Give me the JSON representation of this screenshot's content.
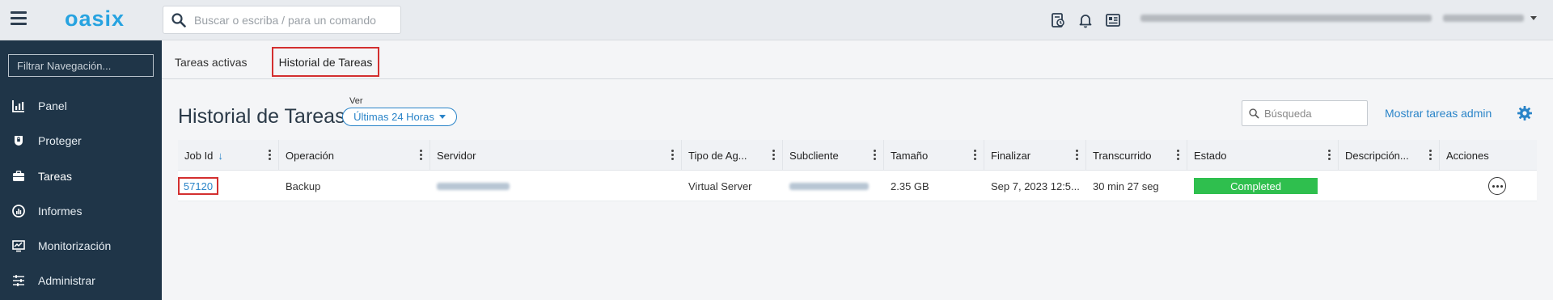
{
  "app": {
    "logo": "oasix"
  },
  "topbar": {
    "search_placeholder": "Buscar o escriba / para un comando",
    "icons": [
      "report-icon",
      "bell-icon",
      "id-card-icon"
    ],
    "user_caret": "chevron-down-icon"
  },
  "sidebar": {
    "filter_placeholder": "Filtrar Navegación...",
    "items": [
      {
        "label": "Panel",
        "icon": "dashboard-icon"
      },
      {
        "label": "Proteger",
        "icon": "shield-icon"
      },
      {
        "label": "Tareas",
        "icon": "briefcase-icon",
        "active": true
      },
      {
        "label": "Informes",
        "icon": "chart-icon"
      },
      {
        "label": "Monitorización",
        "icon": "monitor-icon"
      },
      {
        "label": "Administrar",
        "icon": "sliders-icon"
      }
    ]
  },
  "tabs": [
    {
      "label": "Tareas activas"
    },
    {
      "label": "Historial de Tareas",
      "active": true
    }
  ],
  "header": {
    "title": "Historial de Tareas",
    "ver_label": "Ver",
    "range": "Últimas 24 Horas",
    "search_placeholder": "Búsqueda",
    "admin_link": "Mostrar tareas admin"
  },
  "table": {
    "columns": [
      "Job Id",
      "Operación",
      "Servidor",
      "Tipo de Ag...",
      "Subcliente",
      "Tamaño",
      "Finalizar",
      "Transcurrido",
      "Estado",
      "Descripción...",
      "Acciones"
    ],
    "sort_indicator": "↓",
    "rows": [
      {
        "job_id": "57120",
        "operacion": "Backup",
        "tipo": "Virtual Server",
        "tamano": "2.35 GB",
        "finalizar": "Sep 7, 2023 12:5...",
        "transcurrido": "30 min 27 seg",
        "estado": "Completed",
        "descripcion": ""
      }
    ]
  },
  "colors": {
    "accent": "#2a84c8",
    "status_completed": "#2fbf4e",
    "highlight": "#d32f2f",
    "sidebar_bg": "#1f3548"
  }
}
